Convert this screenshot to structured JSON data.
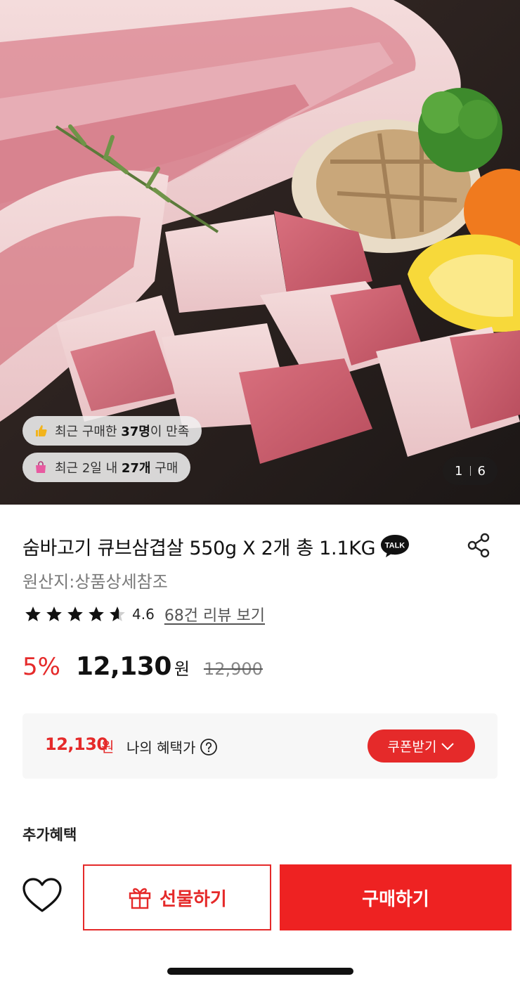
{
  "hero": {
    "social_proof": {
      "satisfaction": {
        "icon": "thumbs-up-icon",
        "prefix": "최근 구매한 ",
        "highlight": "37명",
        "suffix": "이 만족"
      },
      "purchases": {
        "icon": "shopping-bag-icon",
        "prefix": "최근 2일 내 ",
        "highlight": "27개",
        "suffix": " 구매"
      }
    },
    "pager": {
      "current": "1",
      "total": "6"
    }
  },
  "product": {
    "title": "숨바고기 큐브삼겹살 550g X 2개 총 1.1KG",
    "talk_badge": "TALK",
    "origin": "원산지:상품상세참조",
    "rating": {
      "value": "4.6",
      "stars": 4.6,
      "review_link": "68건 리뷰 보기"
    },
    "price": {
      "discount": "5%",
      "sale_price": "12,130",
      "unit": "원",
      "original_price": "12,900"
    }
  },
  "benefit": {
    "price": "12,130",
    "unit": "원",
    "label": "나의 혜택가",
    "coupon_button": "쿠폰받기"
  },
  "extra_benefit_title": "추가혜택",
  "bottom_bar": {
    "gift_label": "선물하기",
    "buy_label": "구매하기"
  },
  "colors": {
    "accent_red": "#e52a2a",
    "buy_red": "#ee2222",
    "muted_text": "#7a7a7a",
    "benefit_bg": "#f7f7f7"
  }
}
